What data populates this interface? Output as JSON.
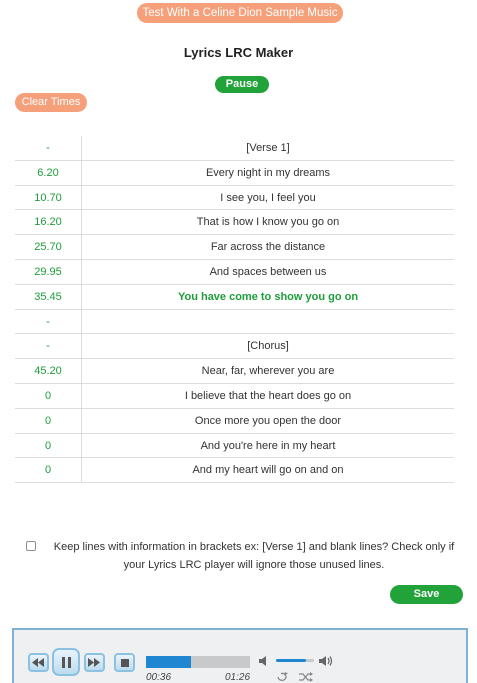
{
  "header": {
    "sample_button_label": "Test With a Celine Dion Sample Music",
    "title": "Lyrics LRC Maker",
    "pause_label": "Pause",
    "clear_times_label": "Clear Times"
  },
  "lyrics_rows": [
    {
      "time": "-",
      "text": "[Verse 1]",
      "current": false
    },
    {
      "time": "6.20",
      "text": "Every night in my dreams",
      "current": false
    },
    {
      "time": "10.70",
      "text": "I see you, I feel you",
      "current": false
    },
    {
      "time": "16.20",
      "text": "That is how I know you go on",
      "current": false
    },
    {
      "time": "25.70",
      "text": "Far across the distance",
      "current": false
    },
    {
      "time": "29.95",
      "text": "And spaces between us",
      "current": false
    },
    {
      "time": "35.45",
      "text": "You have come to show you go on",
      "current": true
    },
    {
      "time": "-",
      "text": "",
      "current": false
    },
    {
      "time": "-",
      "text": "[Chorus]",
      "current": false
    },
    {
      "time": "45.20",
      "text": "Near, far, wherever you are",
      "current": false
    },
    {
      "time": "0",
      "text": "I believe that the heart does go on",
      "current": false
    },
    {
      "time": "0",
      "text": "Once more you open the door",
      "current": false
    },
    {
      "time": "0",
      "text": "And you're here in my heart",
      "current": false
    },
    {
      "time": "0",
      "text": "And my heart will go on and on",
      "current": false
    }
  ],
  "options": {
    "keep_lines_label": "Keep lines with information in brackets ex: [Verse 1] and blank lines? Check only if your Lyrics LRC player will ignore those unused lines.",
    "keep_lines_checked": false
  },
  "save_label": "Save",
  "player": {
    "current_time": "00:36",
    "total_time": "01:26",
    "progress_fraction": 0.43,
    "volume_fraction": 0.8,
    "accent_color": "#1f86d2"
  },
  "colors": {
    "orange_button": "#f5a07a",
    "green_button": "#22a33a",
    "time_green": "#1e9e3a"
  }
}
